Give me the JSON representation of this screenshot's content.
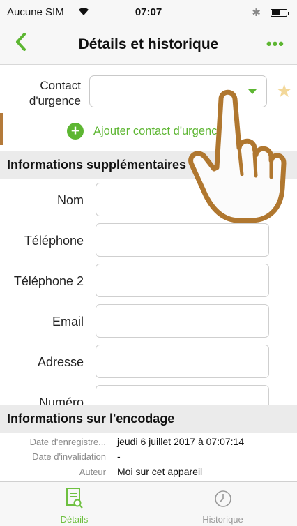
{
  "status_bar": {
    "carrier": "Aucune SIM",
    "time": "07:07"
  },
  "nav": {
    "back_icon": "chevron-left",
    "title": "Détails et historique",
    "more_icon": "ellipsis",
    "accent_color": "#5db632"
  },
  "emergency_contact": {
    "label_line1": "Contact",
    "label_line2": "d'urgence",
    "value": "",
    "favorite_icon": "star"
  },
  "add_contact": {
    "label": "Ajouter contact d'urgence"
  },
  "additional_info": {
    "title": "Informations supplémentaires",
    "fields": [
      {
        "label": "Nom",
        "value": ""
      },
      {
        "label": "Téléphone",
        "value": ""
      },
      {
        "label": "Téléphone 2",
        "value": ""
      },
      {
        "label": "Email",
        "value": ""
      },
      {
        "label": "Adresse",
        "value": ""
      },
      {
        "label": "Numéro",
        "value": ""
      }
    ]
  },
  "encoding": {
    "title": "Informations sur l'encodage",
    "rows": [
      {
        "label": "Date d'enregistre...",
        "value": "jeudi 6 juillet 2017 à 07:07:14"
      },
      {
        "label": "Date d'invalidation",
        "value": "-"
      },
      {
        "label": "Auteur",
        "value": "Moi sur cet appareil"
      }
    ]
  },
  "tabs": [
    {
      "label": "Détails",
      "icon": "document-search-icon",
      "active": true
    },
    {
      "label": "Historique",
      "icon": "clock-icon",
      "active": false
    }
  ]
}
